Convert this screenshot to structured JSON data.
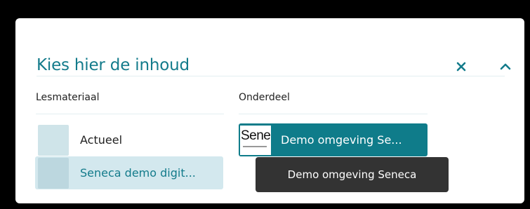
{
  "header": {
    "title": "Kies hier de inhoud"
  },
  "columns": {
    "material_label": "Lesmateriaal",
    "part_label": "Onderdeel"
  },
  "materials": [
    {
      "label": "Actueel",
      "selected": false
    },
    {
      "label": "Seneca demo digit...",
      "selected": true
    }
  ],
  "parts": [
    {
      "label": "Demo omgeving Se...",
      "thumb_text": "Sene",
      "selected": true
    }
  ],
  "tooltip": {
    "text": "Demo omgeving Seneca"
  },
  "colors": {
    "accent": "#137b8b",
    "selected_bg": "#d3e8ee",
    "part_bg": "#0f7c8a",
    "tooltip_bg": "#333333"
  }
}
